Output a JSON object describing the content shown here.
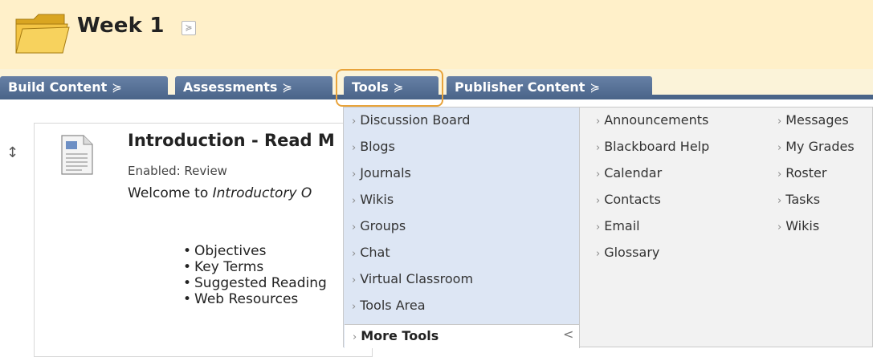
{
  "header": {
    "title": "Week 1",
    "folder_icon": "folder-icon",
    "colors": {
      "header_bg": "#fff0c9",
      "folder": "#f2c13a"
    }
  },
  "actionbar": {
    "buttons": [
      {
        "label": "Build Content",
        "chev": "≽"
      },
      {
        "label": "Assessments",
        "chev": "≽"
      },
      {
        "label": "Tools",
        "chev": "≽"
      },
      {
        "label": "Publisher Content",
        "chev": "≽"
      }
    ],
    "colors": {
      "button_bg": "#4a6488",
      "highlight": "#e8a33b"
    }
  },
  "content": {
    "drag_handle": "↕",
    "item": {
      "title": "Introduction - Read M",
      "status": "Enabled: Review",
      "desc_prefix": "Welcome to ",
      "desc_italic": "Introductory O",
      "bullets": [
        "Objectives",
        "Key Terms",
        "Suggested Reading",
        "Web Resources"
      ]
    }
  },
  "menu": {
    "col1": [
      "Discussion Board",
      "Blogs",
      "Journals",
      "Wikis",
      "Groups",
      "Chat",
      "Virtual Classroom",
      "Tools Area"
    ],
    "col2": [
      "Announcements",
      "Blackboard Help",
      "Calendar",
      "Contacts",
      "Email",
      "Glossary"
    ],
    "col3": [
      "Messages",
      "My Grades",
      "Roster",
      "Tasks",
      "Wikis"
    ],
    "more_tools": "More Tools",
    "more_tools_collapse": "<",
    "arrow": "›"
  }
}
